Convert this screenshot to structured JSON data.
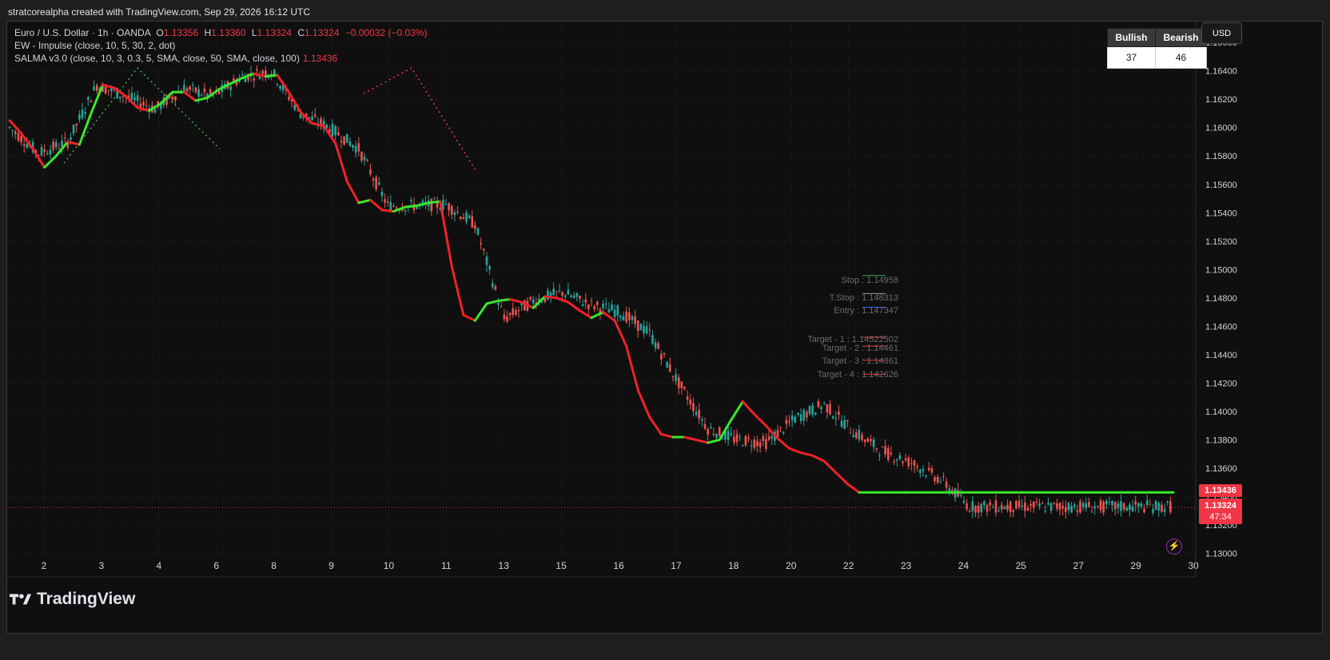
{
  "header": {
    "credit": "stratcorealpha created with TradingView.com, Sep 29, 2026 16:12 UTC"
  },
  "legend": {
    "symbol": "Euro / U.S. Dollar · 1h · OANDA",
    "open_label": "O",
    "open": "1.13356",
    "high_label": "H",
    "high": "1.13360",
    "low_label": "L",
    "low": "1.13324",
    "close_label": "C",
    "close": "1.13324",
    "change": "−0.00032 (−0.03%)",
    "ew_indicator": "EW - Impulse (close, 10, 5, 30, 2, dot)",
    "salma_indicator": "SALMA v3.0 (close, 10, 3, 0.3, 5, SMA, close, 50, SMA, close, 100)",
    "salma_value": "1.13436"
  },
  "sentiment_table": {
    "headers": [
      "Bullish",
      "Bearish"
    ],
    "values": [
      "37",
      "46"
    ]
  },
  "currency_button": "USD",
  "price_tags": {
    "salma": "1.13436",
    "last": "1.13324",
    "countdown": "47:34"
  },
  "trade_levels": {
    "stop": "Stop : 1.14958",
    "tstop": "T.Stop : 1.148313",
    "entry": "Entry : 1.147347",
    "targets": [
      "Target - 1 : 1.14522502",
      "Target - 2 : 1.14461",
      "Target - 3 : 1.14361",
      "Target - 4 : 1.142626"
    ]
  },
  "brand": "TradingView",
  "colors": {
    "background": "#0f0f0f",
    "up": "#26a69a",
    "down": "#ef5350",
    "salma_bull": "#39e62e",
    "salma_bear": "#f0202a",
    "price_tag": "#f23645",
    "grid": "#2a2a2a"
  },
  "chart_data": {
    "type": "line",
    "title": "Euro / U.S. Dollar · 1h · OANDA",
    "y_ticks": [
      "1.13000",
      "1.13200",
      "1.13400",
      "1.13600",
      "1.13800",
      "1.14000",
      "1.14200",
      "1.14400",
      "1.14600",
      "1.14800",
      "1.15000",
      "1.15200",
      "1.15400",
      "1.15600",
      "1.15800",
      "1.16000",
      "1.16200",
      "1.16400",
      "1.16600"
    ],
    "x_ticks": [
      "2",
      "3",
      "4",
      "6",
      "8",
      "9",
      "10",
      "11",
      "13",
      "15",
      "16",
      "17",
      "18",
      "20",
      "22",
      "23",
      "24",
      "25",
      "27",
      "29",
      "30"
    ],
    "ylim": [
      1.1297,
      1.1673
    ],
    "grid": true,
    "series": [
      {
        "name": "SALMA v3.0",
        "x_index": [
          0,
          2,
          4,
          6,
          8,
          10,
          12,
          14,
          16,
          18,
          20,
          22,
          24,
          26,
          28,
          30,
          32,
          34,
          36,
          38,
          40,
          42,
          44,
          46,
          48,
          50,
          52,
          54,
          56,
          58,
          60,
          62,
          64,
          66,
          68,
          70,
          72,
          74,
          76,
          78,
          80,
          82,
          84,
          86,
          88,
          90,
          92,
          94,
          96,
          98,
          100,
          102,
          104,
          106,
          108,
          110,
          112,
          114,
          116,
          118,
          120,
          122,
          124,
          126,
          128,
          130,
          132,
          134,
          136,
          138,
          140,
          142,
          144,
          146,
          148,
          150,
          152,
          154,
          156,
          158,
          160,
          162,
          164,
          166,
          168,
          170,
          172,
          174,
          176,
          178,
          180,
          182,
          184,
          186,
          188,
          190,
          192,
          194,
          196,
          198,
          200
        ],
        "values": [
          1.1605,
          1.1596,
          1.1585,
          1.1572,
          1.158,
          1.159,
          1.1588,
          1.161,
          1.163,
          1.1628,
          1.1622,
          1.1614,
          1.1612,
          1.1617,
          1.1625,
          1.1625,
          1.1619,
          1.1621,
          1.1627,
          1.1631,
          1.1635,
          1.1638,
          1.1636,
          1.1637,
          1.1625,
          1.1611,
          1.1603,
          1.1601,
          1.1589,
          1.1562,
          1.1547,
          1.1549,
          1.1542,
          1.1541,
          1.1544,
          1.1545,
          1.1547,
          1.1548,
          1.1502,
          1.1468,
          1.1464,
          1.1476,
          1.1478,
          1.1479,
          1.1477,
          1.1473,
          1.1481,
          1.148,
          1.1477,
          1.1471,
          1.1466,
          1.147,
          1.1464,
          1.1446,
          1.1415,
          1.1396,
          1.1384,
          1.1382,
          1.1382,
          1.138,
          1.1378,
          1.138,
          1.1394,
          1.1407,
          1.1398,
          1.139,
          1.1381,
          1.1374,
          1.1371,
          1.1369,
          1.1365,
          1.1357,
          1.1349,
          1.1343,
          1.1343,
          1.1343,
          1.1343,
          1.1343,
          1.1343,
          1.1343,
          1.1343,
          1.1343,
          1.1343,
          1.1343,
          1.1343,
          1.1343,
          1.1343,
          1.1343,
          1.1343,
          1.1343,
          1.1343,
          1.1343,
          1.1343,
          1.1343,
          1.1343,
          1.1343,
          1.1343,
          1.1343,
          1.1343,
          1.1343,
          1.1343
        ]
      }
    ],
    "price_path": {
      "x_index": [
        0,
        5,
        10,
        15,
        20,
        25,
        30,
        35,
        40,
        45,
        50,
        55,
        60,
        65,
        70,
        75,
        80,
        85,
        90,
        95,
        100,
        105,
        110,
        115,
        120,
        125,
        130,
        135,
        140,
        145,
        150,
        155,
        160,
        165,
        170,
        175,
        180,
        185,
        190,
        195,
        200
      ],
      "values": [
        1.16,
        1.1582,
        1.159,
        1.163,
        1.1622,
        1.1613,
        1.1628,
        1.1622,
        1.1636,
        1.164,
        1.161,
        1.16,
        1.1585,
        1.1545,
        1.1545,
        1.1546,
        1.1532,
        1.1465,
        1.1478,
        1.1484,
        1.1475,
        1.147,
        1.1455,
        1.142,
        1.1388,
        1.138,
        1.1378,
        1.1395,
        1.1405,
        1.1386,
        1.1372,
        1.1364,
        1.1352,
        1.1333,
        1.1333,
        1.1333,
        1.1333,
        1.1333,
        1.1333,
        1.1333,
        1.1333
      ]
    },
    "last_price": 1.13324
  }
}
